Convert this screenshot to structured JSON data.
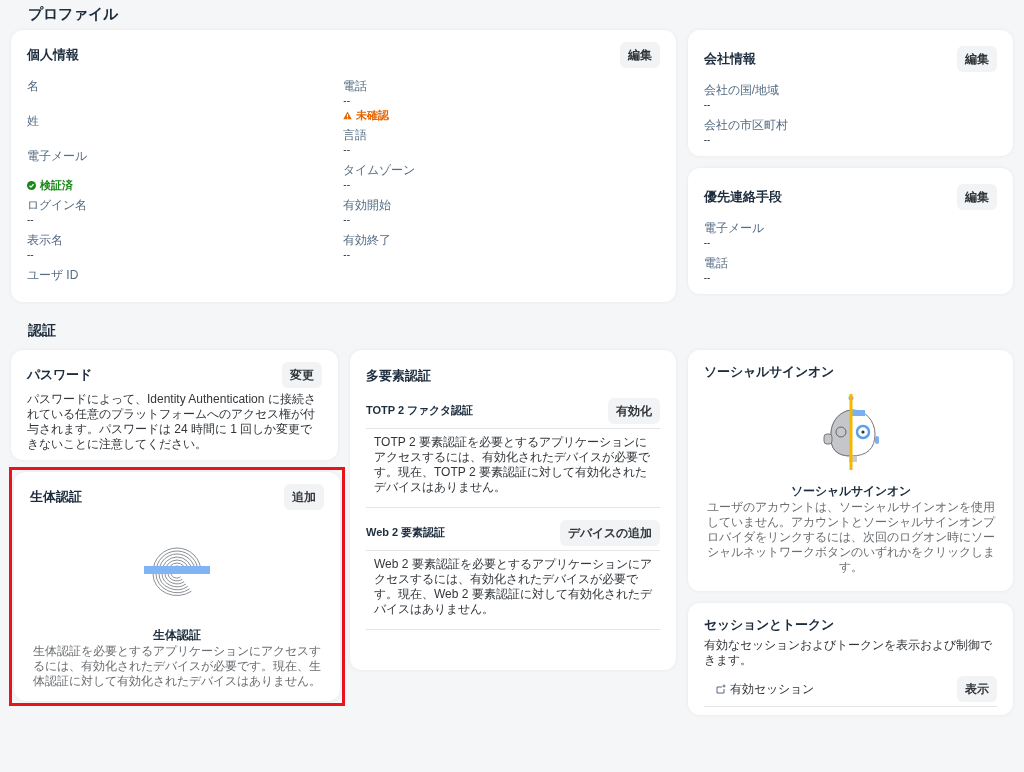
{
  "page_title": "プロファイル",
  "personal": {
    "title": "個人情報",
    "button": "編集",
    "left": [
      {
        "label": "名"
      },
      {
        "label": "姓"
      },
      {
        "label": "電子メール",
        "status": {
          "kind": "verified",
          "text": "検証済"
        }
      },
      {
        "label": "ログイン名",
        "value": "--"
      },
      {
        "label": "表示名",
        "value": "--"
      },
      {
        "label": "ユーザ ID"
      }
    ],
    "right": [
      {
        "label": "電話",
        "value": "--",
        "status": {
          "kind": "unverified",
          "text": "未確認"
        }
      },
      {
        "label": "言語",
        "value": "--"
      },
      {
        "label": "タイムゾーン",
        "value": "--"
      },
      {
        "label": "有効開始",
        "value": "--"
      },
      {
        "label": "有効終了",
        "value": "--"
      }
    ]
  },
  "company": {
    "title": "会社情報",
    "button": "編集",
    "fields": [
      {
        "label": "会社の国/地域",
        "value": "--"
      },
      {
        "label": "会社の市区町村",
        "value": "--"
      }
    ]
  },
  "contact": {
    "title": "優先連絡手段",
    "button": "編集",
    "fields": [
      {
        "label": "電子メール",
        "value": "--"
      },
      {
        "label": "電話",
        "value": "--"
      }
    ]
  },
  "auth_title": "認証",
  "password": {
    "title": "パスワード",
    "button": "変更",
    "text": "パスワードによって、Identity Authentication に接続されている任意のプラットフォームへのアクセス権が付与されます。パスワードは 24 時間に 1 回しか変更できないことに注意してください。"
  },
  "biometric": {
    "title": "生体認証",
    "button": "追加",
    "highlighted": true,
    "empty_title": "生体認証",
    "empty_text": "生体認証を必要とするアプリケーションにアクセスするには、有効化されたデバイスが必要です。現在、生体認証に対して有効化されたデバイスはありません。"
  },
  "mfa": {
    "title": "多要素認証",
    "sections": [
      {
        "title": "TOTP 2 ファクタ認証",
        "button": "有効化",
        "text": "TOTP 2 要素認証を必要とするアプリケーションにアクセスするには、有効化されたデバイスが必要です。現在、TOTP 2 要素認証に対して有効化されたデバイスはありません。"
      },
      {
        "title": "Web 2 要素認証",
        "button": "デバイスの追加",
        "text": "Web 2 要素認証を必要とするアプリケーションにアクセスするには、有効化されたデバイスが必要です。現在、Web 2 要素認証に対して有効化されたデバイスはありません。"
      }
    ]
  },
  "social": {
    "title": "ソーシャルサインオン",
    "empty_title": "ソーシャルサインオン",
    "empty_text": "ユーザのアカウントは、ソーシャルサインオンを使用していません。アカウントとソーシャルサインオンプロバイダをリンクするには、次回のログオン時にソーシャルネットワークボタンのいずれかをクリックします。"
  },
  "sessions": {
    "title": "セッションとトークン",
    "text": "有効なセッションおよびトークンを表示および制御できます。",
    "row_label": "有効セッション",
    "button": "表示"
  }
}
